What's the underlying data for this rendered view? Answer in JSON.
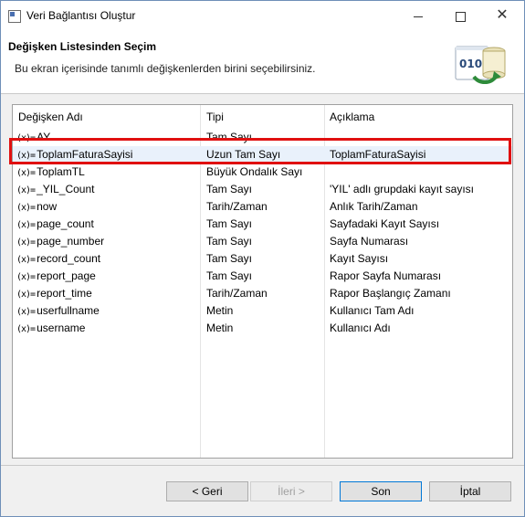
{
  "window": {
    "title": "Veri Bağlantısı Oluştur"
  },
  "header": {
    "title": "Değişken Listesinden Seçim",
    "description": "Bu ekran içerisinde tanımlı değişkenlerden birini seçebilirsiniz.",
    "wizard_icon_text": "010"
  },
  "table": {
    "columns": [
      "Değişken Adı",
      "Tipi",
      "Açıklama"
    ],
    "var_icon": "(x)=",
    "rows": [
      {
        "name": "AY",
        "type": "Tam Sayı",
        "desc": ""
      },
      {
        "name": "ToplamFaturaSayisi",
        "type": "Uzun Tam Sayı",
        "desc": "ToplamFaturaSayisi"
      },
      {
        "name": "ToplamTL",
        "type": "Büyük Ondalık Sayı",
        "desc": ""
      },
      {
        "name": "_YIL_Count",
        "type": "Tam Sayı",
        "desc": "'YIL' adlı grupdaki kayıt sayısı"
      },
      {
        "name": "now",
        "type": "Tarih/Zaman",
        "desc": "Anlık Tarih/Zaman"
      },
      {
        "name": "page_count",
        "type": "Tam Sayı",
        "desc": "Sayfadaki Kayıt Sayısı"
      },
      {
        "name": "page_number",
        "type": "Tam Sayı",
        "desc": "Sayfa Numarası"
      },
      {
        "name": "record_count",
        "type": "Tam Sayı",
        "desc": "Kayıt Sayısı"
      },
      {
        "name": "report_page",
        "type": "Tam Sayı",
        "desc": "Rapor Sayfa Numarası"
      },
      {
        "name": "report_time",
        "type": "Tarih/Zaman",
        "desc": "Rapor Başlangıç Zamanı"
      },
      {
        "name": "userfullname",
        "type": "Metin",
        "desc": "Kullanıcı Tam Adı"
      },
      {
        "name": "username",
        "type": "Metin",
        "desc": "Kullanıcı Adı"
      }
    ],
    "selected_row": "ToplamFaturaSayisi"
  },
  "buttons": {
    "back": "< Geri",
    "next": "İleri >",
    "finish": "Son",
    "cancel": "İptal"
  },
  "colors": {
    "highlight": "#e01010",
    "selection": "#e9f1fb",
    "default_button_border": "#0078d7"
  }
}
